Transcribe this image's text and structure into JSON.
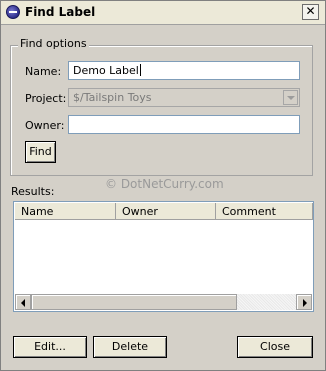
{
  "window": {
    "title": "Find Label",
    "close_glyph": "✕",
    "icon": "app-icon"
  },
  "find_options": {
    "legend": "Find options",
    "name_label": "Name:",
    "name_value": "Demo Label",
    "project_label": "Project:",
    "project_value": "$/Tailspin Toys",
    "owner_label": "Owner:",
    "owner_value": "",
    "find_button": "Find"
  },
  "watermark": "© DotNetCurry.com",
  "results": {
    "label": "Results:",
    "columns": [
      "Name",
      "Owner",
      "Comment"
    ]
  },
  "buttons": {
    "edit": "Edit...",
    "delete": "Delete",
    "close": "Close"
  }
}
